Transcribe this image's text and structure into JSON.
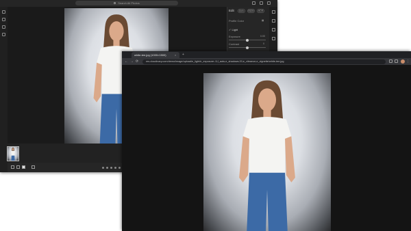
{
  "editor": {
    "search_placeholder": "Search All Photos",
    "panel": {
      "title": "Edit",
      "buttons": [
        "Auto",
        "B&W",
        "HDR"
      ],
      "profile_label": "Profile",
      "profile_value": "Color",
      "section": "Light",
      "slider1_label": "Exposure",
      "slider1_value": "0.00",
      "slider2_label": "Contrast",
      "slider2_value": "0"
    }
  },
  "browser": {
    "tab_title": "white-tee.jpg (1000×1500)",
    "url": "res.cloudinary.com/demo/image/upload/e_light/e_exposure:-5,f_auto,e_shadows:20,e_vibrance,e_vignette/white-tee.jpg",
    "new_tab_symbol": "+",
    "close_symbol": "×",
    "menu_symbol": "⋮",
    "nav_symbols": [
      "←",
      "→",
      "⟳"
    ]
  },
  "icons": {
    "left_rail": [
      "image-icon",
      "edit-icon",
      "people-icon",
      "filter-icon"
    ],
    "right_rail": [
      "adjust-icon",
      "crop-icon",
      "brush-icon",
      "info-icon"
    ]
  },
  "colors": {
    "editor_bg": "#1b1b1b",
    "browser_bg": "#121212",
    "shirt": "#f4f4f2",
    "jeans": "#3c6aa6",
    "hair": "#6a4a33",
    "skin": "#dba98a"
  }
}
